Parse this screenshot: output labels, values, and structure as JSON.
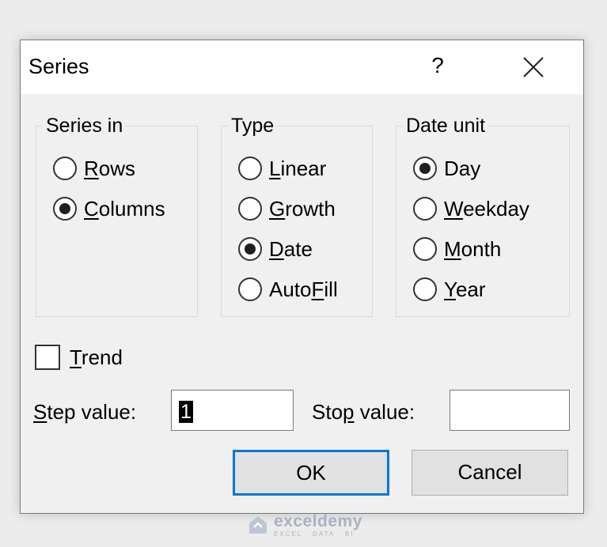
{
  "dialog": {
    "title": "Series",
    "help_symbol": "?"
  },
  "series_in": {
    "legend": "Series in",
    "options": [
      {
        "label": "Rows",
        "accel": "R",
        "rest": "ows",
        "selected": false
      },
      {
        "label": "Columns",
        "accel": "C",
        "rest": "olumns",
        "selected": true
      }
    ]
  },
  "type": {
    "legend": "Type",
    "options": [
      {
        "label": "Linear",
        "accel": "L",
        "rest": "inear",
        "selected": false
      },
      {
        "label": "Growth",
        "accel": "G",
        "rest": "rowth",
        "selected": false
      },
      {
        "label": "Date",
        "accel": "D",
        "rest": "ate",
        "selected": true
      },
      {
        "label": "AutoFill",
        "pre": "Auto",
        "accel": "F",
        "rest": "ill",
        "selected": false
      }
    ]
  },
  "date_unit": {
    "legend": "Date unit",
    "options": [
      {
        "label": "Day",
        "accel": "",
        "rest": "Day",
        "selected": true
      },
      {
        "label": "Weekday",
        "accel": "W",
        "rest": "eekday",
        "selected": false
      },
      {
        "label": "Month",
        "accel": "M",
        "rest": "onth",
        "selected": false
      },
      {
        "label": "Year",
        "accel": "Y",
        "rest": "ear",
        "selected": false
      }
    ]
  },
  "trend": {
    "accel": "T",
    "rest": "rend",
    "checked": false
  },
  "step": {
    "label_accel": "S",
    "label_rest": "tep value:",
    "value": "1"
  },
  "stop": {
    "label_pre": "Sto",
    "label_accel": "p",
    "label_rest": " value:",
    "value": ""
  },
  "buttons": {
    "ok": "OK",
    "cancel": "Cancel"
  },
  "watermark": {
    "name": "exceldemy",
    "tagline": "EXCEL · DATA · BI"
  },
  "colors": {
    "focus_accent": "#0078d7",
    "dialog_bg": "#f0f0f0",
    "titlebar_bg": "#ffffff"
  },
  "icons": {
    "close": "close-x-icon",
    "watermark_logo": "exceldemy-logo-icon"
  }
}
